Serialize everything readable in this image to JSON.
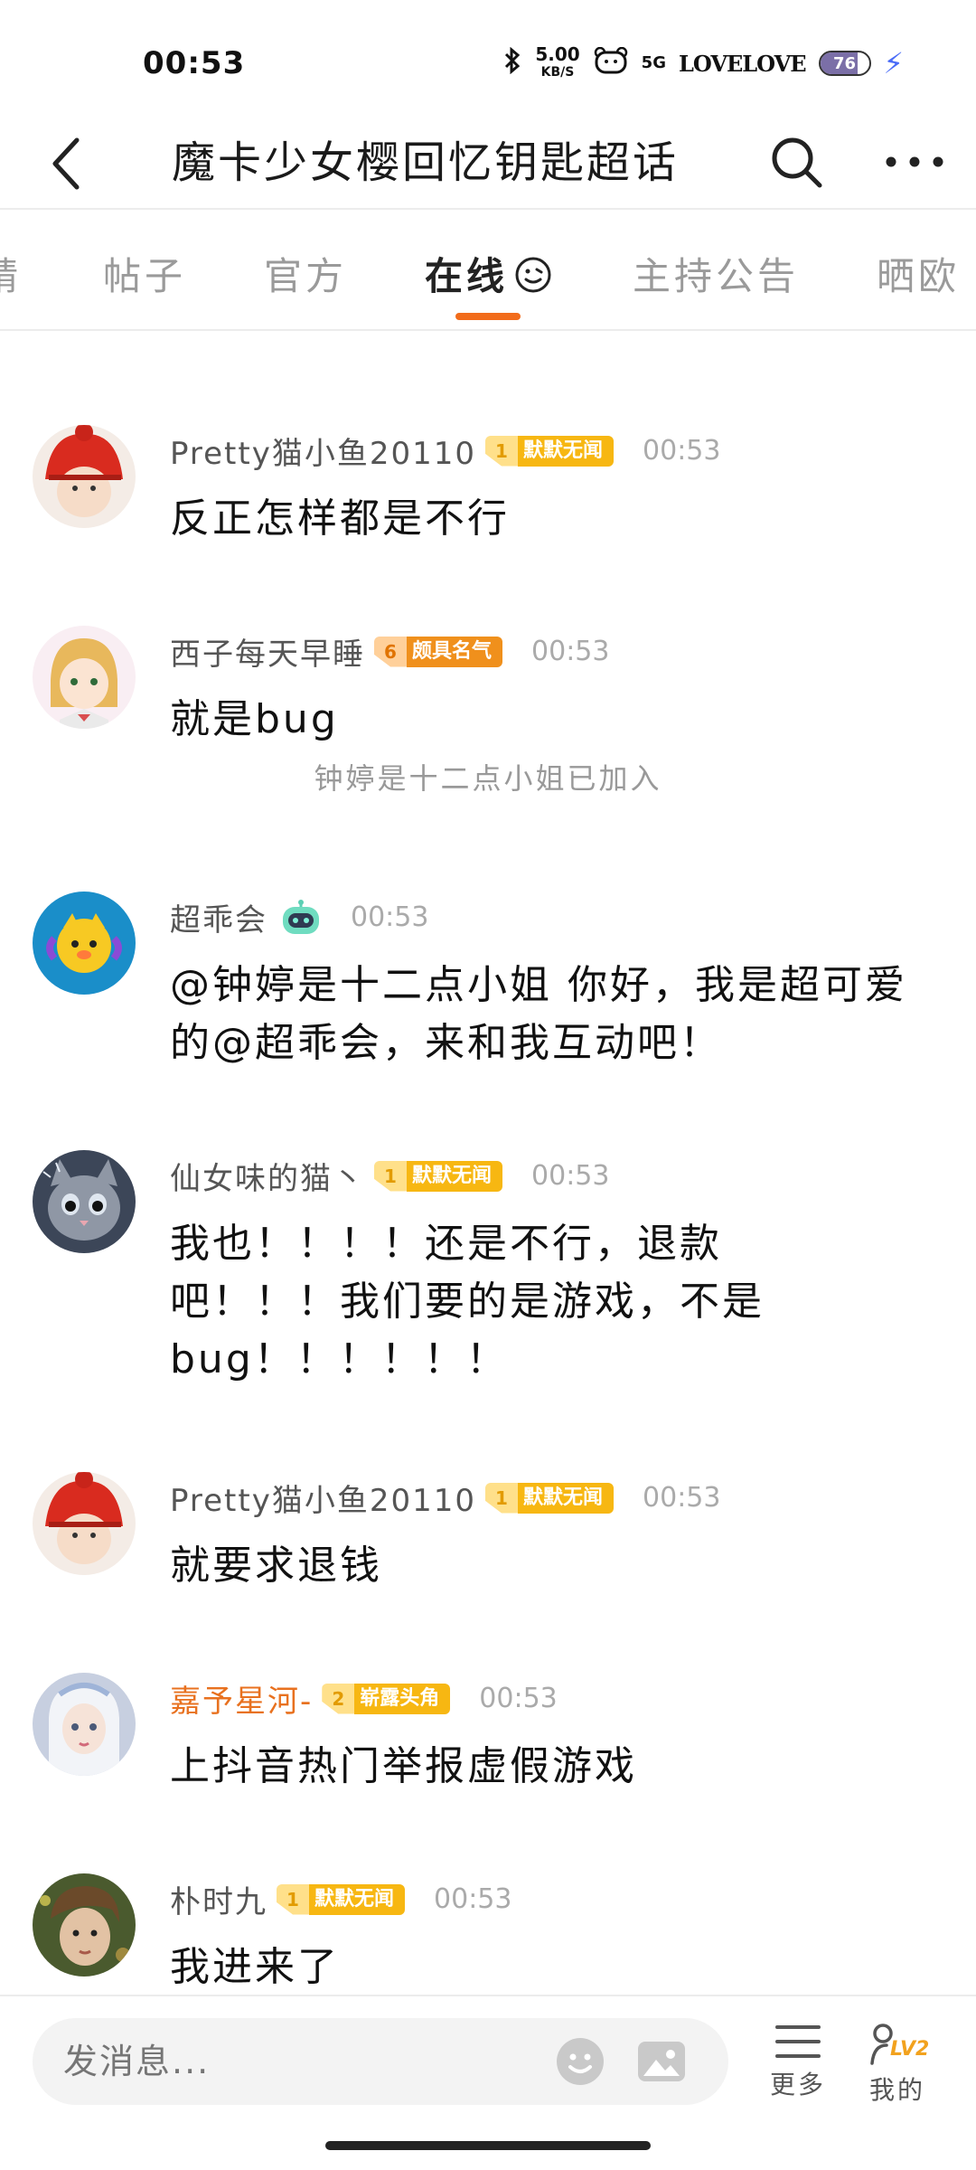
{
  "status_bar": {
    "time": "00:53",
    "net_speed": "5.00",
    "net_speed_unit": "KB/S",
    "network": "5G",
    "love_text": "LOVELOVE",
    "battery_level": "76",
    "battery_fraction": 0.76
  },
  "header": {
    "title": "魔卡少女樱回忆钥匙超话"
  },
  "tabs": [
    {
      "label": "精"
    },
    {
      "label": "帖子"
    },
    {
      "label": "官方"
    },
    {
      "label": "在线",
      "active": true
    },
    {
      "label": "主持公告"
    },
    {
      "label": "晒欧"
    }
  ],
  "messages": [
    {
      "user": "Pretty猫小鱼20110",
      "level": "1",
      "badge": "默默无闻",
      "time": "00:53",
      "text": "反正怎样都是不行"
    },
    {
      "user": "西子每天早睡",
      "level": "6",
      "badge": "颇具名气",
      "time": "00:53",
      "text": "就是bug"
    },
    {
      "system": "钟婷是十二点小姐已加入"
    },
    {
      "user": "超乖会",
      "time": "00:53",
      "text": "@钟婷是十二点小姐 你好，我是超可爱的@超乖会，来和我互动吧！"
    },
    {
      "user": "仙女味的猫丶",
      "level": "1",
      "badge": "默默无闻",
      "time": "00:53",
      "text": "我也！！！！还是不行，退款吧！！！我们要的是游戏，不是bug！！！！！！"
    },
    {
      "user": "Pretty猫小鱼20110",
      "level": "1",
      "badge": "默默无闻",
      "time": "00:53",
      "text": "就要求退钱"
    },
    {
      "user": "嘉予星河-",
      "level": "2",
      "badge": "崭露头角",
      "time": "00:53",
      "text": "上抖音热门举报虚假游戏"
    },
    {
      "user": "朴时九",
      "level": "1",
      "badge": "默默无闻",
      "time": "00:53",
      "text": "我进来了"
    }
  ],
  "input": {
    "placeholder": "发消息..."
  },
  "bottom_buttons": {
    "more": "更多",
    "mine": "我的",
    "level_tag": "LV2"
  },
  "colors": {
    "accent": "#f26c1b",
    "badge_yellow": "#f7b712",
    "badge_orange": "#f0901c",
    "username_highlight": "#e8711f"
  },
  "icons": [
    "back-arrow-icon",
    "search-icon",
    "more-dots-icon",
    "smiley-icon",
    "robot-icon",
    "emoji-icon",
    "image-icon",
    "list-icon",
    "profile-icon"
  ]
}
